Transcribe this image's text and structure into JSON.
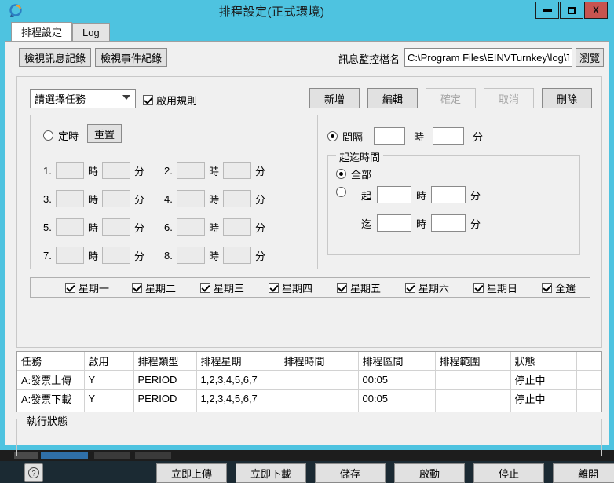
{
  "window": {
    "title": "排程設定(正式環境)",
    "icon": "app-icon",
    "minimize_label": "",
    "maximize_label": "",
    "close_label": "X",
    "accent_color": "#4ec3e0",
    "close_color": "#c75450"
  },
  "tabs": [
    {
      "label": "排程設定",
      "active": true
    },
    {
      "label": "Log",
      "active": false
    }
  ],
  "toolbar": {
    "view_message_log": "檢視訊息記錄",
    "view_event_log": "檢視事件紀錄",
    "monitor_file_label": "訊息監控檔名",
    "monitor_file_value": "C:\\Program Files\\EINVTurnkey\\log\\T",
    "monitor_file_placeholder": "",
    "browse": "瀏覽"
  },
  "rule": {
    "task_select_value": "請選擇任務",
    "enable_rule_label": "啟用規則",
    "enable_rule_checked": true,
    "buttons": [
      {
        "label": "新增",
        "enabled": true
      },
      {
        "label": "編輯",
        "enabled": true
      },
      {
        "label": "確定",
        "enabled": false
      },
      {
        "label": "取消",
        "enabled": false
      },
      {
        "label": "刪除",
        "enabled": true
      }
    ]
  },
  "fixed_panel": {
    "radio_label": "定時",
    "radio_selected": false,
    "reset_label": "重置",
    "hour_unit": "時",
    "minute_unit": "分",
    "rows": [
      {
        "index": "1.",
        "hour": "",
        "minute": ""
      },
      {
        "index": "2.",
        "hour": "",
        "minute": ""
      },
      {
        "index": "3.",
        "hour": "",
        "minute": ""
      },
      {
        "index": "4.",
        "hour": "",
        "minute": ""
      },
      {
        "index": "5.",
        "hour": "",
        "minute": ""
      },
      {
        "index": "6.",
        "hour": "",
        "minute": ""
      },
      {
        "index": "7.",
        "hour": "",
        "minute": ""
      },
      {
        "index": "8.",
        "hour": "",
        "minute": ""
      }
    ]
  },
  "interval_panel": {
    "radio_label": "間隔",
    "radio_selected": true,
    "hour_unit": "時",
    "minute_unit": "分",
    "interval_hour": "",
    "interval_minute": "",
    "range_group_title": "起迄時間",
    "all_label": "全部",
    "all_selected": true,
    "custom_selected": false,
    "from_label": "起",
    "to_label": "迄",
    "from_hour": "",
    "from_minute": "",
    "to_hour": "",
    "to_minute": ""
  },
  "weekdays": [
    {
      "label": "星期一",
      "checked": true
    },
    {
      "label": "星期二",
      "checked": true
    },
    {
      "label": "星期三",
      "checked": true
    },
    {
      "label": "星期四",
      "checked": true
    },
    {
      "label": "星期五",
      "checked": true
    },
    {
      "label": "星期六",
      "checked": true
    },
    {
      "label": "星期日",
      "checked": true
    },
    {
      "label": "全選",
      "checked": true
    }
  ],
  "grid": {
    "columns": [
      "任務",
      "啟用",
      "排程類型",
      "排程星期",
      "排程時間",
      "排程區間",
      "排程範圍",
      "狀態",
      ""
    ],
    "rows": [
      [
        "A:發票上傳",
        "Y",
        "PERIOD",
        "1,2,3,4,5,6,7",
        "",
        "00:05",
        "",
        "停止中",
        ""
      ],
      [
        "A:發票下載",
        "Y",
        "PERIOD",
        "1,2,3,4,5,6,7",
        "",
        "00:05",
        "",
        "停止中",
        ""
      ],
      [
        "",
        "",
        "",
        "",
        "",
        "",
        "",
        "",
        ""
      ]
    ]
  },
  "status": {
    "group_title": "執行狀態",
    "text": ""
  },
  "footer": {
    "help_label": "?",
    "buttons": [
      {
        "label": "立即上傳"
      },
      {
        "label": "立即下載"
      },
      {
        "label": "儲存"
      },
      {
        "label": "啟動"
      },
      {
        "label": "停止"
      },
      {
        "label": "離開"
      }
    ]
  }
}
